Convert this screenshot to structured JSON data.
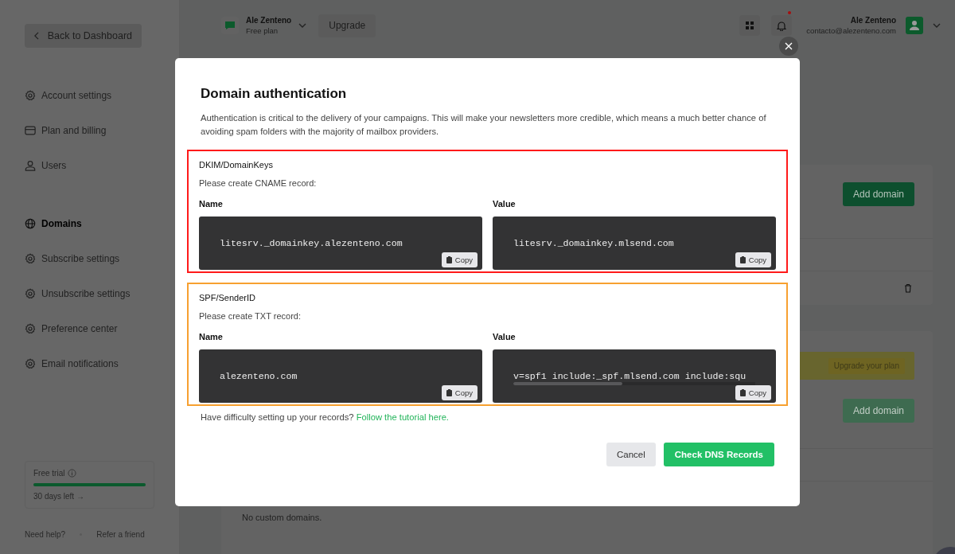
{
  "sidebar": {
    "back_button": "Back to Dashboard",
    "items": [
      {
        "label": "Account settings",
        "kind": "gear",
        "selected": false
      },
      {
        "label": "Plan and billing",
        "kind": "card",
        "selected": false
      },
      {
        "label": "Users",
        "kind": "user",
        "selected": false
      },
      {
        "label": "Domains",
        "kind": "globe",
        "selected": true
      },
      {
        "label": "Subscribe settings",
        "kind": "gear",
        "selected": false
      },
      {
        "label": "Unsubscribe settings",
        "kind": "gear",
        "selected": false
      },
      {
        "label": "Preference center",
        "kind": "gear",
        "selected": false
      },
      {
        "label": "Email notifications",
        "kind": "gear",
        "selected": false
      }
    ],
    "trial": {
      "label": "Free trial",
      "level": 1,
      "link": "30 days left →"
    },
    "footer_links": [
      "Need help?",
      "Refer a friend"
    ]
  },
  "header": {
    "account": {
      "name": "Ale Zenteno",
      "plan": "Free plan"
    },
    "upgrade_button": "Upgrade",
    "notifications_unread": true,
    "user": {
      "name": "Ale Zenteno",
      "email": "contacto@alezenteno.com"
    }
  },
  "main": {
    "sending_card": {
      "button": "Add domain"
    },
    "custom_card": {
      "banner_button": "Upgrade your plan",
      "button": "Add domain",
      "button_disabled": true,
      "empty_text": "No custom domains."
    }
  },
  "modal": {
    "title": "Domain authentication",
    "description": "Authentication is critical to the delivery of your campaigns. This will make your newsletters more credible, which means a much better chance of avoiding spam folders with the majority of mailbox providers.",
    "sections": [
      {
        "title": "DKIM/DomainKeys",
        "instruction": "Please create CNAME record:",
        "color": "#ff1a1a",
        "records": [
          {
            "label": "Name",
            "value": "litesrv._domainkey.alezenteno.com",
            "copy": "Copy",
            "scrollbar": false
          },
          {
            "label": "Value",
            "value": "litesrv._domainkey.mlsend.com",
            "copy": "Copy",
            "scrollbar": false
          }
        ]
      },
      {
        "title": "SPF/SenderID",
        "instruction": "Please create TXT record:",
        "color": "#f7a030",
        "records": [
          {
            "label": "Name",
            "value": "alezenteno.com",
            "copy": "Copy",
            "scrollbar": false
          },
          {
            "label": "Value",
            "value": "v=spf1 include:_spf.mlsend.com include:squ",
            "copy": "Copy",
            "scrollbar": true
          }
        ]
      }
    ],
    "help_text": "Have difficulty setting up your records?",
    "help_link": "Follow the tutorial here.",
    "cancel_button": "Cancel",
    "confirm_button": "Check DNS Records"
  }
}
